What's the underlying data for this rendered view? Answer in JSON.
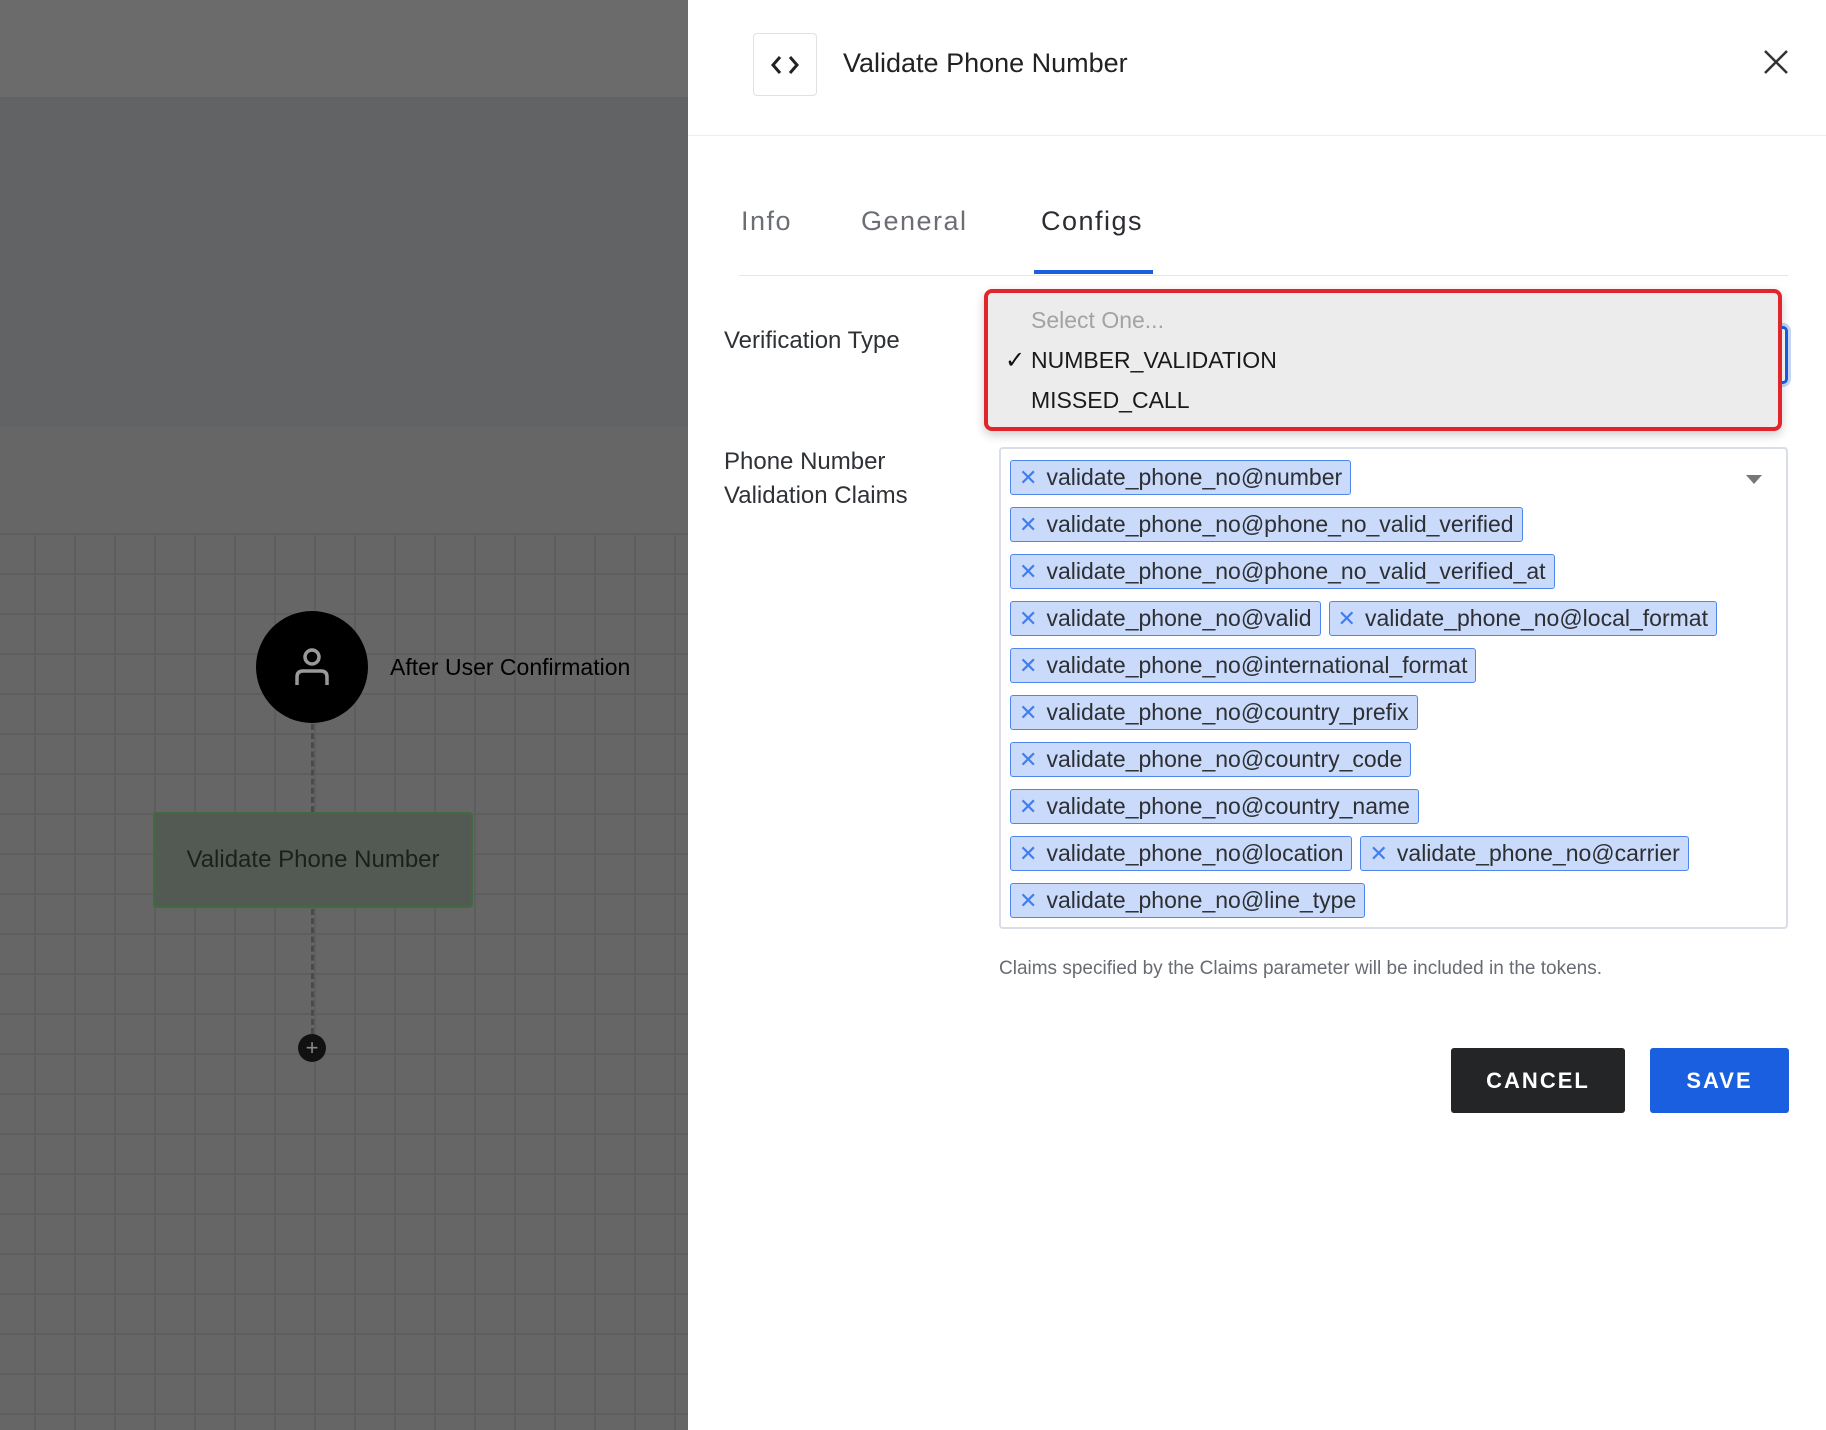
{
  "canvas": {
    "start_node_label": "After User Confirmation",
    "step_node_label": "Validate Phone Number",
    "add_symbol": "+"
  },
  "panel": {
    "title": "Validate Phone Number",
    "tabs": [
      {
        "label": "Info"
      },
      {
        "label": "General"
      },
      {
        "label": "Configs",
        "active": true
      }
    ],
    "verification_type": {
      "label": "Verification Type",
      "selected": "NUMBER_VALIDATION",
      "options": [
        "Select One...",
        "NUMBER_VALIDATION",
        "MISSED_CALL"
      ],
      "check": "✓"
    },
    "claims": {
      "label_line1": "Phone Number",
      "label_line2": "Validation Claims",
      "remove_symbol": "✕",
      "values": [
        "validate_phone_no@number",
        "validate_phone_no@phone_no_valid_verified",
        "validate_phone_no@phone_no_valid_verified_at",
        "validate_phone_no@valid",
        "validate_phone_no@local_format",
        "validate_phone_no@international_format",
        "validate_phone_no@country_prefix",
        "validate_phone_no@country_code",
        "validate_phone_no@country_name",
        "validate_phone_no@location",
        "validate_phone_no@carrier",
        "validate_phone_no@line_type"
      ],
      "help": "Claims specified by the Claims parameter will be included in the tokens."
    },
    "cancel_label": "CANCEL",
    "save_label": "SAVE"
  },
  "colors": {
    "accent": "#1a5fe0",
    "highlight_border": "#e0252b",
    "chip_bg": "#c9dafa"
  }
}
